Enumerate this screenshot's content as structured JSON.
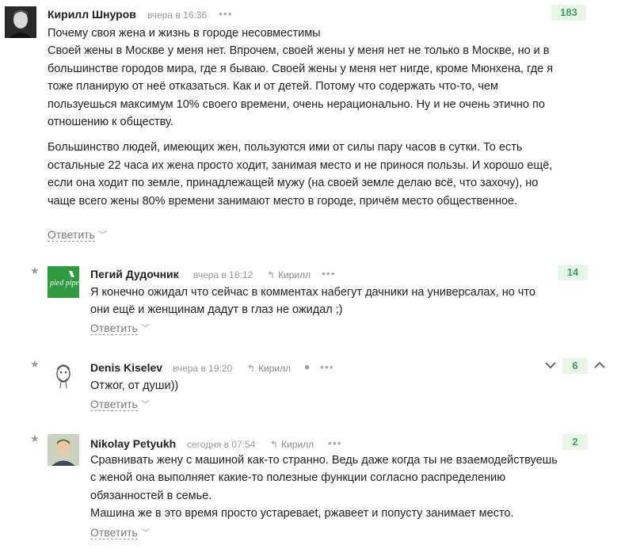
{
  "comments": [
    {
      "author": "Кирилл Шнуров",
      "time": "вчера в 16:36",
      "score": "183",
      "reply_to": "",
      "paragraphs": [
        "Почему своя жена и жизнь в городе несовместимы",
        "Своей жены в Москве у меня нет. Впрочем, своей жены у меня нет не только в Москве, но и в большинстве городов мира, где я бываю. Своей жены у меня нет нигде, кроме Мюнхена, где я тоже планирую от неё отказаться. Как и от детей. Потому что содержать что-то, чем пользуешься максимум 10% своего времени, очень нерационально. Ну и не очень этично по отношению к обществу.",
        "Большинство людей, имеющих жен, пользуются ими от силы пару часов в сутки. То есть остальные 22 часа их жена просто ходит, занимая место и не принося пользы. И хорошо ещё, если она ходит по земле, принадлежащей мужу (на своей земле делаю всё, что захочу), но чаще всего жены 80% времени занимают место в городе, причём место общественное."
      ],
      "answer": "Ответить"
    },
    {
      "author": "Пегий Дудочник",
      "time": "вчера в 18:12",
      "score": "14",
      "reply_to": "Кирилл",
      "avatar_text": "pied piper",
      "paragraphs": [
        "Я конечно ожидал что сейчас в комментах набегут дачники на универсалах, но что они ещё и женщинам дадут в глаз не ожидал ;)"
      ],
      "answer": "Ответить"
    },
    {
      "author": "Denis Kiselev",
      "time": "вчера в 19:20",
      "score": "6",
      "reply_to": "Кирилл",
      "paragraphs": [
        "Отжог, от души))"
      ],
      "answer": "Ответить"
    },
    {
      "author": "Nikolay Petyukh",
      "time": "сегодня в 07:54",
      "score": "2",
      "reply_to": "Кирилл",
      "paragraphs": [
        "Сравнивать жену с машиной как-то странно. Ведь даже когда ты не взаемодействуешь с женой она выполняет какие-то полезные функции согласно распределению обязанностей в семье.",
        "Машина же в это время просто устареваеt, ржавеет и попусту занимает место."
      ],
      "answer": "Ответить"
    }
  ],
  "icons": {
    "more": "more-dots-icon",
    "reply": "reply-arrow-icon",
    "star": "star-icon",
    "apple": "apple-icon",
    "vote_up": "chevron-up-icon",
    "vote_down": "chevron-down-icon"
  },
  "colors": {
    "score_bg": "#e8f6e8",
    "score_text": "#3aa35a",
    "piedpiper": "#2e9b3f"
  }
}
